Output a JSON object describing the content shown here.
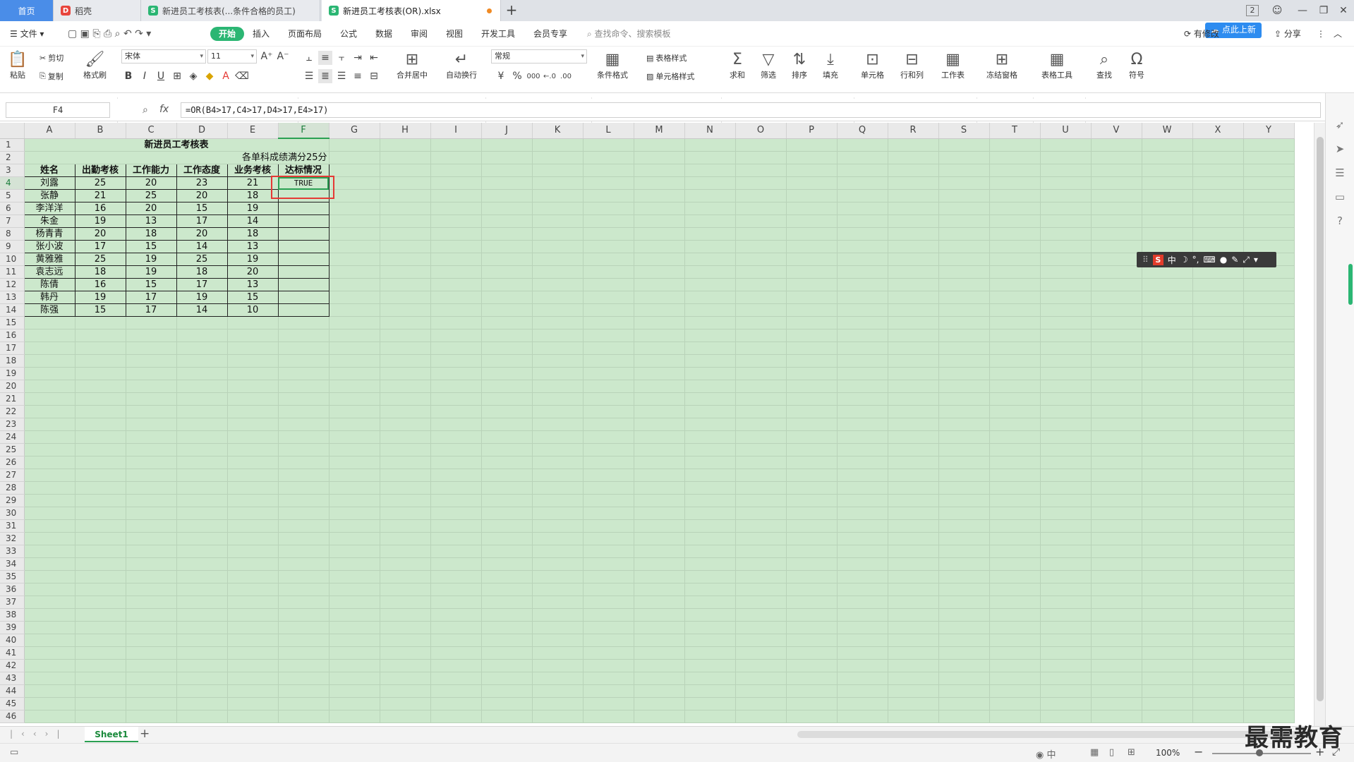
{
  "tabs": {
    "home": "首页",
    "items": [
      {
        "label": "稻壳"
      },
      {
        "label": "新进员工考核表(...条件合格的员工)"
      },
      {
        "label": "新进员工考核表(OR).xlsx"
      }
    ],
    "add": "+"
  },
  "window": {
    "badge": "2",
    "min": "—",
    "restore": "❐",
    "close": "✕"
  },
  "menubar": {
    "file": "文件",
    "items": [
      "开始",
      "插入",
      "页面布局",
      "公式",
      "数据",
      "审阅",
      "视图",
      "开发工具",
      "会员专享"
    ],
    "search_placeholder": "查找命令、搜索模板",
    "right": [
      "有修改",
      "分享"
    ],
    "tour_btn": "点此上新"
  },
  "ribbon": {
    "paste": "粘贴",
    "cut": "剪切",
    "copy": "复制",
    "format_painter": "格式刷",
    "font_name": "宋体",
    "font_size": "11",
    "merge_center": "合并居中",
    "wrap": "自动换行",
    "number_format": "常规",
    "currency": "¥",
    "percent": "%",
    "thousands": "000",
    "cond_format": "条件格式",
    "table_style": "表格样式",
    "cell_style": "单元格样式",
    "sum": "求和",
    "filter": "筛选",
    "sort": "排序",
    "fill": "填充",
    "cell": "单元格",
    "row_col": "行和列",
    "worksheet": "工作表",
    "freeze": "冻结窗格",
    "table_tools": "表格工具",
    "find": "查找",
    "symbol": "符号"
  },
  "formula_bar": {
    "name_box": "F4",
    "fx": "fx",
    "formula": "=OR(B4>17,C4>17,D4>17,E4>17)"
  },
  "columns": [
    "A",
    "B",
    "C",
    "D",
    "E",
    "F",
    "G",
    "H",
    "I",
    "J",
    "K",
    "L",
    "M",
    "N",
    "O",
    "P",
    "Q",
    "R",
    "S",
    "T",
    "U",
    "V",
    "W",
    "X",
    "Y"
  ],
  "sheet": {
    "title": "新进员工考核表",
    "note": "各单科成绩满分25分",
    "headers": [
      "姓名",
      "出勤考核",
      "工作能力",
      "工作态度",
      "业务考核",
      "达标情况"
    ],
    "rows": [
      [
        "刘露",
        "25",
        "20",
        "23",
        "21",
        "TRUE"
      ],
      [
        "张静",
        "21",
        "25",
        "20",
        "18",
        ""
      ],
      [
        "李洋洋",
        "16",
        "20",
        "15",
        "19",
        ""
      ],
      [
        "朱金",
        "19",
        "13",
        "17",
        "14",
        ""
      ],
      [
        "杨青青",
        "20",
        "18",
        "20",
        "18",
        ""
      ],
      [
        "张小波",
        "17",
        "15",
        "14",
        "13",
        ""
      ],
      [
        "黄雅雅",
        "25",
        "19",
        "25",
        "19",
        ""
      ],
      [
        "袁志远",
        "18",
        "19",
        "18",
        "20",
        ""
      ],
      [
        "陈倩",
        "16",
        "15",
        "17",
        "13",
        ""
      ],
      [
        "韩丹",
        "19",
        "17",
        "19",
        "15",
        ""
      ],
      [
        "陈强",
        "15",
        "17",
        "14",
        "10",
        ""
      ]
    ]
  },
  "ime": {
    "logo": "S",
    "mode": "中"
  },
  "sheet_tabs": {
    "name": "Sheet1",
    "add": "+"
  },
  "status": {
    "zoom": "100%"
  },
  "watermark": "最需教育",
  "colors": {
    "accent": "#2bb673",
    "grid_bg": "#cce8cc",
    "highlight_red": "#e53935"
  }
}
